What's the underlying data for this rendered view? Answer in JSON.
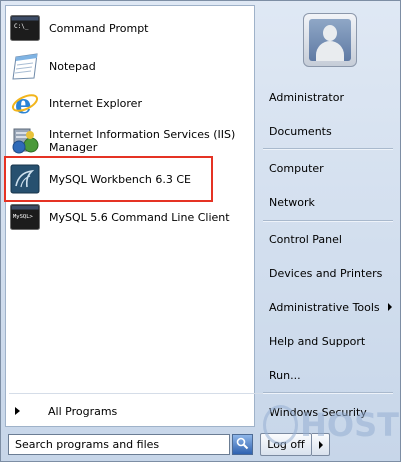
{
  "programs": [
    {
      "label": "Command Prompt",
      "icon": "command-prompt-icon"
    },
    {
      "label": "Notepad",
      "icon": "notepad-icon"
    },
    {
      "label": "Internet Explorer",
      "icon": "internet-explorer-icon"
    },
    {
      "label_line1": "Internet Information Services (IIS)",
      "label_line2": "Manager",
      "icon": "iis-manager-icon"
    },
    {
      "label": "MySQL Workbench 6.3 CE",
      "icon": "mysql-workbench-icon"
    },
    {
      "label": "MySQL 5.6 Command Line Client",
      "icon": "mysql-cli-icon"
    }
  ],
  "all_programs_label": "All Programs",
  "search": {
    "placeholder": "Search programs and files",
    "icon": "search-icon"
  },
  "right_menu": {
    "administrator": "Administrator",
    "documents": "Documents",
    "computer": "Computer",
    "network": "Network",
    "control_panel": "Control Panel",
    "devices_printers": "Devices and Printers",
    "admin_tools": "Administrative Tools",
    "help_support": "Help and Support",
    "run": "Run...",
    "windows_security": "Windows Security",
    "log_off": "Log off"
  },
  "watermark_text": "HOST",
  "colors": {
    "highlight_border": "#e53324",
    "accent": "#2f62b0"
  }
}
